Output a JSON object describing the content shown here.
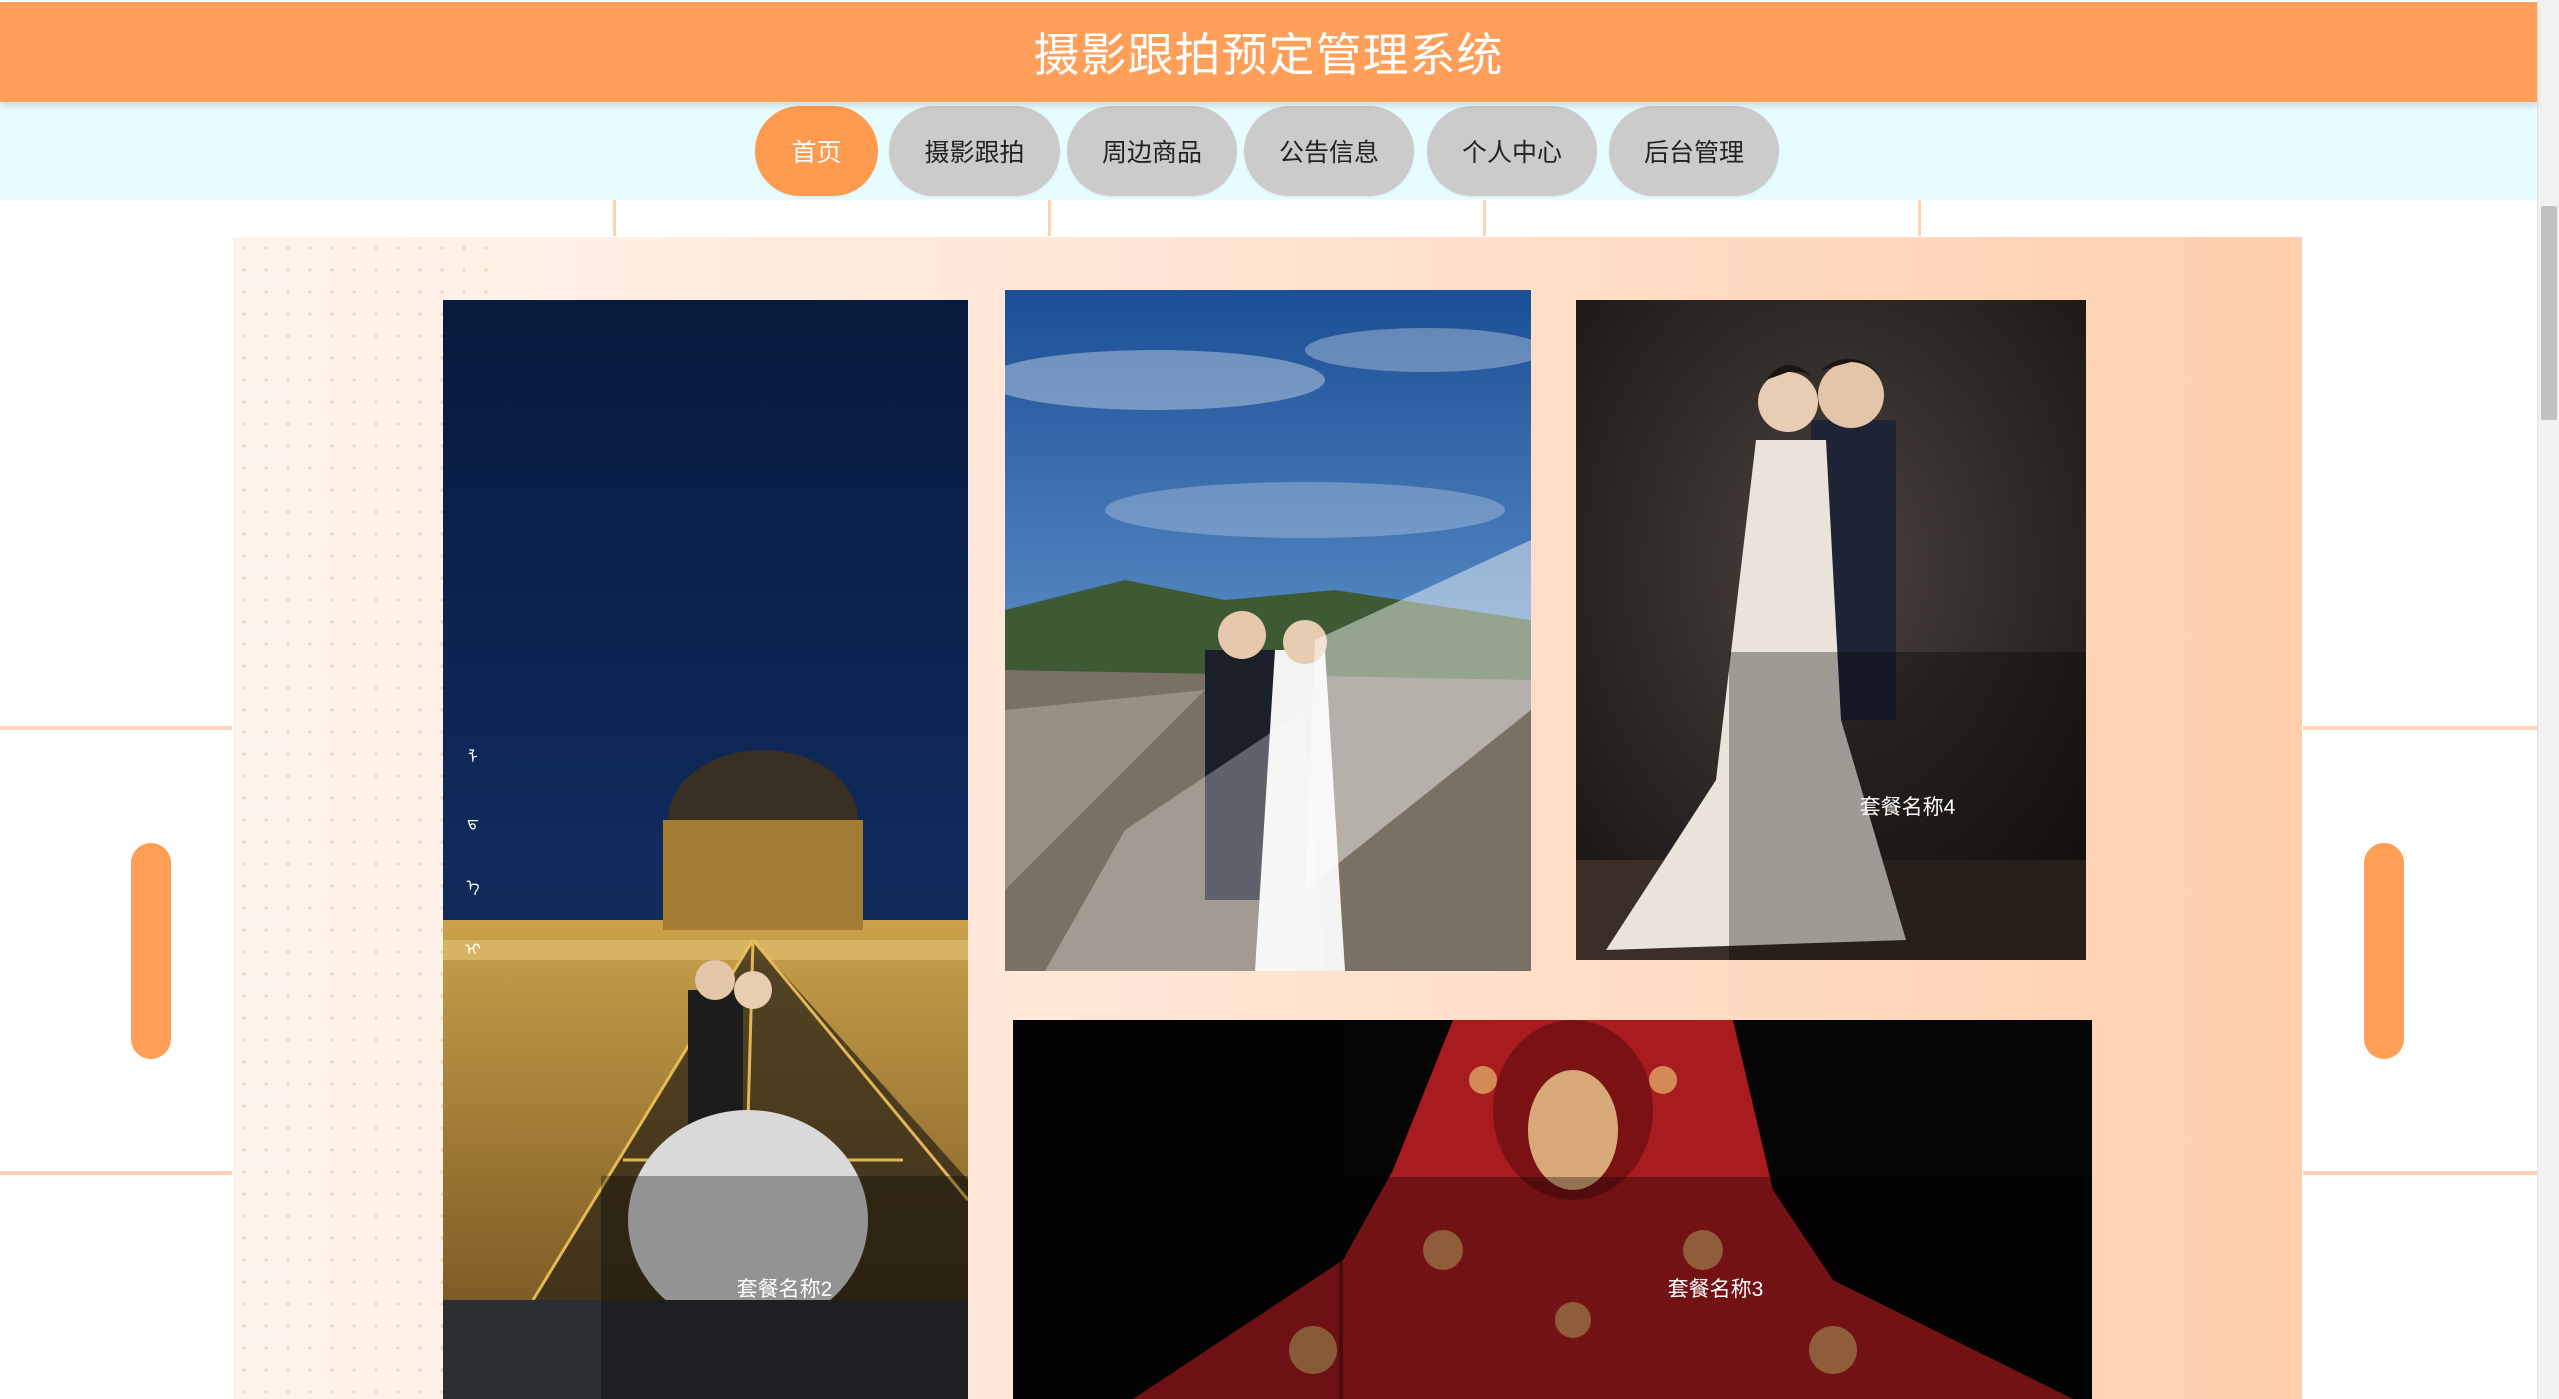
{
  "header": {
    "title": "摄影跟拍预定管理系统"
  },
  "nav": {
    "items": [
      {
        "label": "首页",
        "active": true
      },
      {
        "label": "摄影跟拍",
        "active": false
      },
      {
        "label": "周边商品",
        "active": false
      },
      {
        "label": "公告信息",
        "active": false
      },
      {
        "label": "个人中心",
        "active": false
      },
      {
        "label": "后台管理",
        "active": false
      }
    ]
  },
  "packages": {
    "card1": {
      "caption": "套餐名称2",
      "side_glyphs": [
        "ᠯ",
        "ᠳ",
        "ᠡ",
        "ᠢ"
      ]
    },
    "card2": {
      "caption": ""
    },
    "card3": {
      "caption": "套餐名称4"
    },
    "card4": {
      "caption": "套餐名称3"
    }
  },
  "colors": {
    "header_bg": "#ff9f5a",
    "nav_bg": "#e6fcfe",
    "nav_active": "#ff9b4f",
    "nav_inactive": "#cbcbcb",
    "panel_accent": "#ffcfae"
  }
}
